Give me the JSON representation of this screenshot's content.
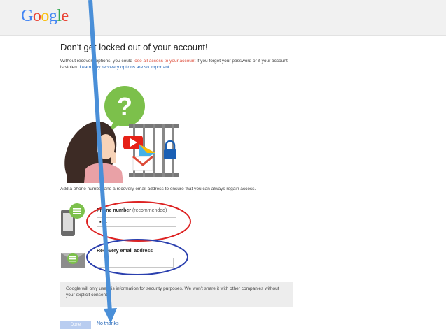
{
  "header": {
    "logo_letters": [
      {
        "char": "G",
        "color": "#4285f4"
      },
      {
        "char": "o",
        "color": "#ea4335"
      },
      {
        "char": "o",
        "color": "#fbbc05"
      },
      {
        "char": "g",
        "color": "#4285f4"
      },
      {
        "char": "l",
        "color": "#34a853"
      },
      {
        "char": "e",
        "color": "#ea4335"
      }
    ]
  },
  "main": {
    "title": "Don't get locked out of your account!",
    "intro_part1": "Without recovery options, you could ",
    "intro_red": "lose all access to your account",
    "intro_part2": " if you forget your password or if your account is stolen. ",
    "intro_link": "Learn why recovery options are so important",
    "add_line": "Add a phone number and a recovery email address to ensure that you can always regain access.",
    "phone": {
      "label": "Phone number",
      "label_note": "(recommended)",
      "value": "▪▪ –"
    },
    "email": {
      "label": "Recovery email address",
      "value": ""
    },
    "notice": "Google will only use this information for security purposes. We won't share it with other companies without your explicit consent.",
    "done_label": "Done",
    "no_thanks_label": "No thanks"
  },
  "colors": {
    "accent_blue": "#1a5fb4",
    "annotation_red": "#dd2222",
    "annotation_blue": "#2a3fae",
    "arrow": "#4a8fd8"
  },
  "icons": [
    "question-mark-icon",
    "youtube-icon",
    "play-store-icon",
    "gmail-icon",
    "padlock-icon",
    "phone-icon",
    "chat-bubble-icon",
    "envelope-icon"
  ]
}
